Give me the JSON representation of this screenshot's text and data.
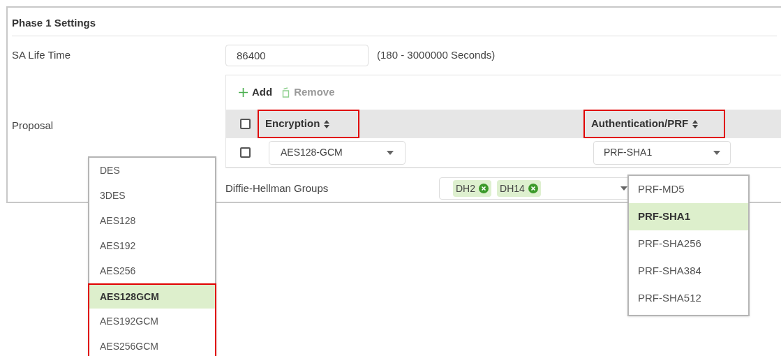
{
  "panel": {
    "title": "Phase 1 Settings"
  },
  "sa_life_time": {
    "label": "SA Life Time",
    "value": "86400",
    "hint": "(180 - 3000000 Seconds)"
  },
  "proposal": {
    "label": "Proposal",
    "toolbar": [
      {
        "kind": "add",
        "label": "Add",
        "disabled": false
      },
      {
        "kind": "remove",
        "label": "Remove",
        "disabled": true
      }
    ],
    "select_all_checked": false,
    "columns": [
      {
        "label": "Encryption",
        "highlighted": true
      },
      {
        "label": "Authentication/PRF",
        "highlighted": true
      }
    ],
    "rows": [
      {
        "checked": false,
        "encryption": "AES128-GCM",
        "authentication": "PRF-SHA1"
      }
    ]
  },
  "dh_groups": {
    "label": "Diffie-Hellman Groups",
    "tags": [
      "DH2",
      "DH14"
    ]
  },
  "encryption_dropdown": {
    "options": [
      {
        "label": "DES",
        "selected": false,
        "highlighted": false
      },
      {
        "label": "3DES",
        "selected": false,
        "highlighted": false
      },
      {
        "label": "AES128",
        "selected": false,
        "highlighted": false
      },
      {
        "label": "AES192",
        "selected": false,
        "highlighted": false
      },
      {
        "label": "AES256",
        "selected": false,
        "highlighted": false
      },
      {
        "label": "AES128GCM",
        "selected": true,
        "highlighted": true
      },
      {
        "label": "AES192GCM",
        "selected": false,
        "highlighted": true
      },
      {
        "label": "AES256GCM",
        "selected": false,
        "highlighted": true
      }
    ]
  },
  "prf_dropdown": {
    "options": [
      {
        "label": "PRF-MD5",
        "selected": false
      },
      {
        "label": "PRF-SHA1",
        "selected": true
      },
      {
        "label": "PRF-SHA256",
        "selected": false
      },
      {
        "label": "PRF-SHA384",
        "selected": false
      },
      {
        "label": "PRF-SHA512",
        "selected": false
      }
    ]
  }
}
